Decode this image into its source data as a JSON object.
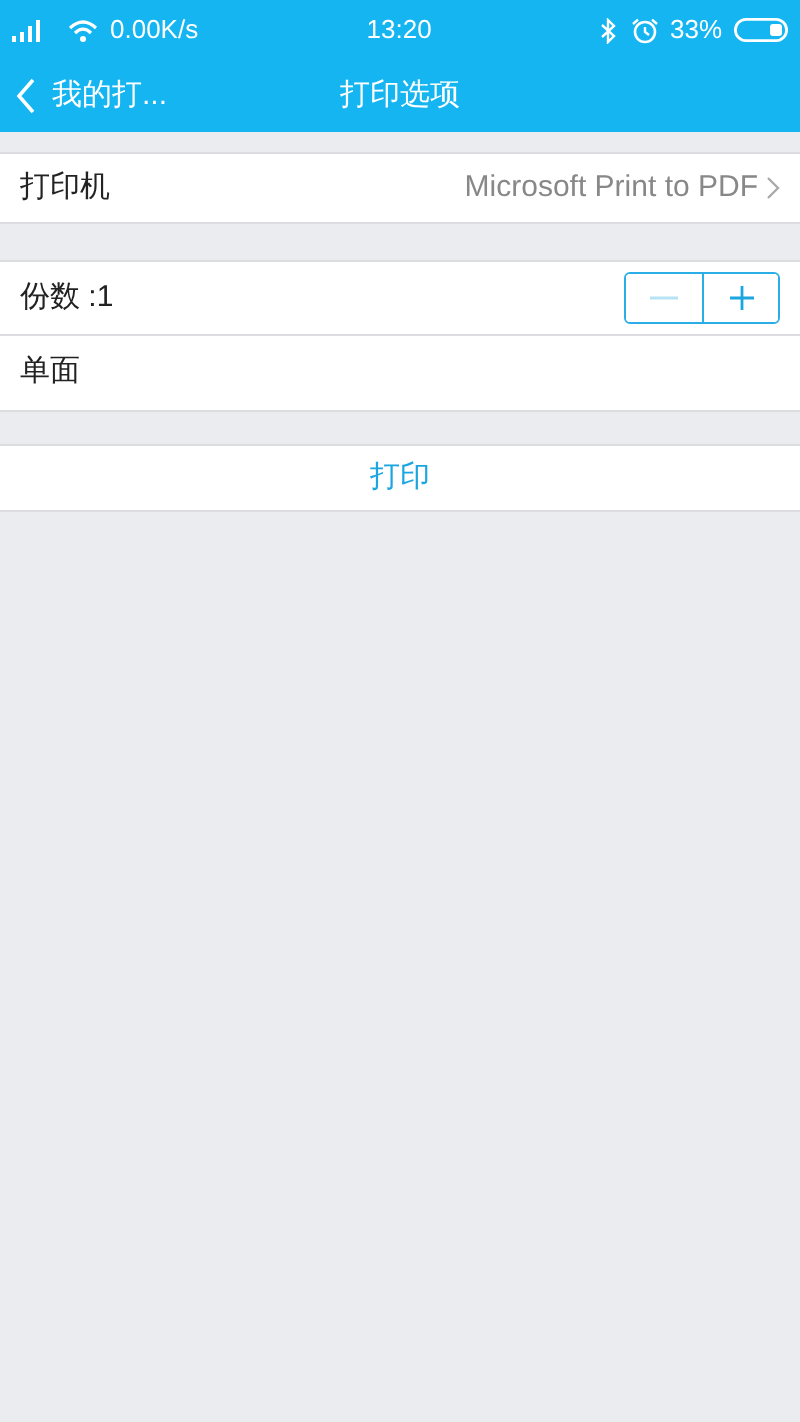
{
  "status_bar": {
    "speed": "0.00K/s",
    "time": "13:20",
    "battery": "33%"
  },
  "nav": {
    "back_label": "我的打...",
    "title": "打印选项"
  },
  "printer_row": {
    "label": "打印机",
    "value": "Microsoft Print to PDF"
  },
  "copies_row": {
    "label": "份数 :1",
    "buttons": [
      {
        "kind": "minus",
        "disabled": true
      },
      {
        "kind": "plus",
        "disabled": false
      }
    ]
  },
  "duplex_row": {
    "label": "单面"
  },
  "print_button": {
    "label": "打印"
  }
}
